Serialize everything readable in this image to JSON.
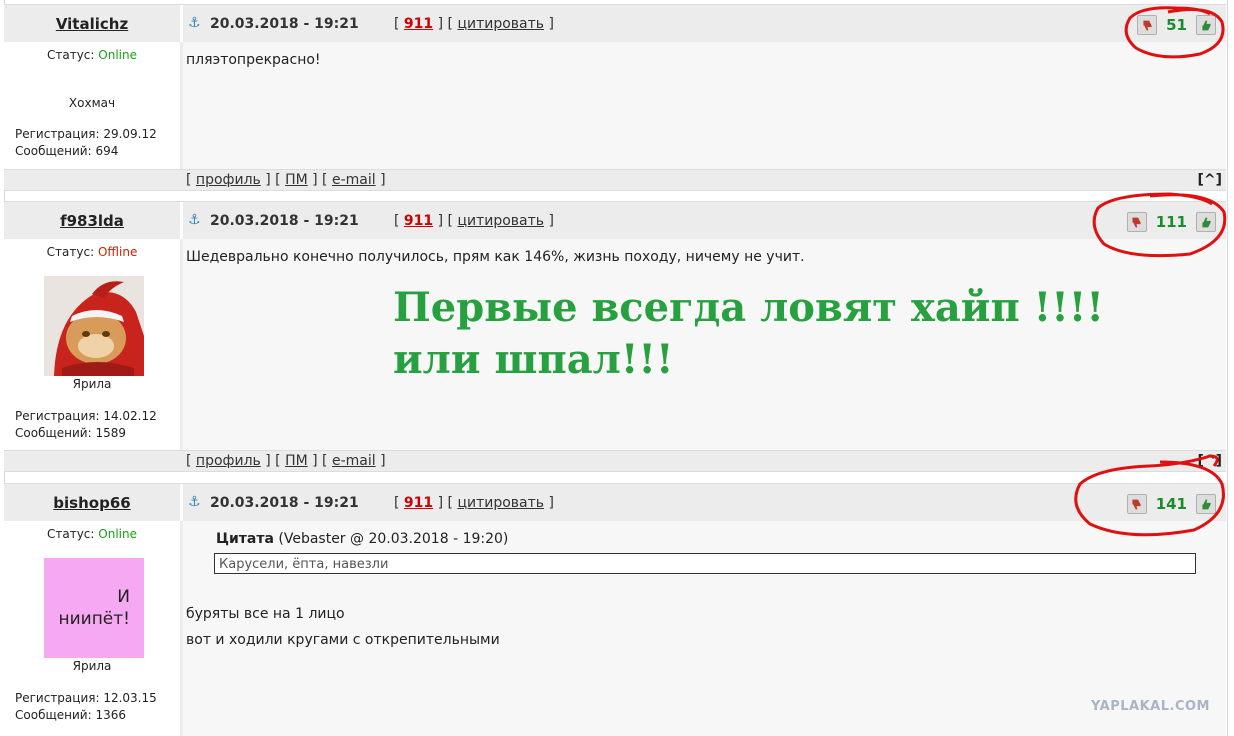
{
  "posts": [
    {
      "username": "Vitalichz",
      "date": "20.03.2018 - 19:21",
      "link_open": "[",
      "post_num": "911",
      "link_mid": "] [",
      "cite_label": "цитировать",
      "link_close": "]",
      "score": "51",
      "status_label": "Статус:",
      "status_value": "Online",
      "group": "Хохмач",
      "registration": "Регистрация: 29.09.12",
      "messages": "Сообщений: 694",
      "text": "пляэтопрекрасно!"
    },
    {
      "username": "f983lda",
      "date": "20.03.2018 - 19:21",
      "link_open": "[",
      "post_num": "911",
      "link_mid": "] [",
      "cite_label": "цитировать",
      "link_close": "]",
      "score": "111",
      "status_label": "Статус:",
      "status_value": "Offline",
      "group": "Ярила",
      "registration": "Регистрация: 14.02.12",
      "messages": "Сообщений: 1589",
      "text": "Шедеврально конечно получилось, прям как 146%, жизнь походу, ничему не учит."
    },
    {
      "username": "bishop66",
      "date": "20.03.2018 - 19:21",
      "link_open": "[",
      "post_num": "911",
      "link_mid": "] [",
      "cite_label": "цитировать",
      "link_close": "]",
      "score": "141",
      "status_label": "Статус:",
      "status_value": "Online",
      "group": "Ярила",
      "registration": "Регистрация: 12.03.15",
      "messages": "Сообщений: 1366",
      "avatar_text": "И ниипёт!",
      "quote_title": "Цитата",
      "quote_meta": "(Vebaster @ 20.03.2018 - 19:20)",
      "quote_text": "Карусели, ёпта, навезли",
      "text_line1": "буряты все на 1 лицо",
      "text_line2": "вот и ходили кругами с открепительными"
    }
  ],
  "footer": {
    "b1": "[",
    "profile": "профиль",
    "b2": "] [",
    "pm": "ПМ",
    "b3": "] [",
    "email": "e-mail",
    "b4": "]",
    "to_top": "[^]"
  },
  "overlay_text": {
    "line1": "Первые всегда ловят хайп !!!!",
    "line2": "или шпал!!!"
  },
  "watermark": "YAPLAKAL.COM",
  "colors": {
    "score_green": "#1a8c2a",
    "circle_red": "#e01010",
    "overlay_green": "#27a03f",
    "online": "#16a316",
    "offline": "#cc2200"
  }
}
